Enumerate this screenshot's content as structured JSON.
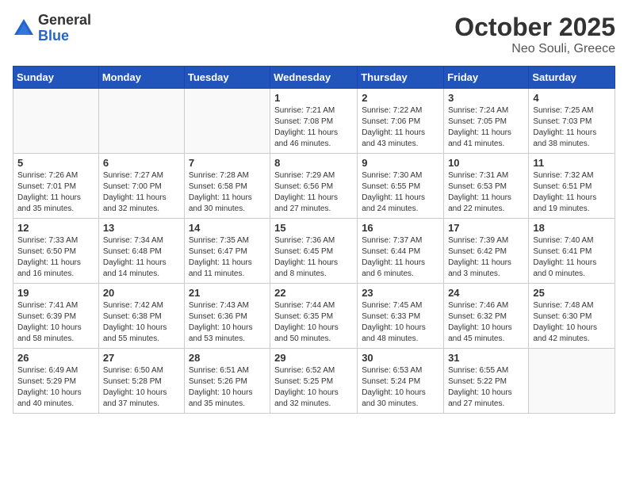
{
  "header": {
    "logo_general": "General",
    "logo_blue": "Blue",
    "month_year": "October 2025",
    "location": "Neo Souli, Greece"
  },
  "weekdays": [
    "Sunday",
    "Monday",
    "Tuesday",
    "Wednesday",
    "Thursday",
    "Friday",
    "Saturday"
  ],
  "weeks": [
    [
      {
        "day": "",
        "info": ""
      },
      {
        "day": "",
        "info": ""
      },
      {
        "day": "",
        "info": ""
      },
      {
        "day": "1",
        "info": "Sunrise: 7:21 AM\nSunset: 7:08 PM\nDaylight: 11 hours\nand 46 minutes."
      },
      {
        "day": "2",
        "info": "Sunrise: 7:22 AM\nSunset: 7:06 PM\nDaylight: 11 hours\nand 43 minutes."
      },
      {
        "day": "3",
        "info": "Sunrise: 7:24 AM\nSunset: 7:05 PM\nDaylight: 11 hours\nand 41 minutes."
      },
      {
        "day": "4",
        "info": "Sunrise: 7:25 AM\nSunset: 7:03 PM\nDaylight: 11 hours\nand 38 minutes."
      }
    ],
    [
      {
        "day": "5",
        "info": "Sunrise: 7:26 AM\nSunset: 7:01 PM\nDaylight: 11 hours\nand 35 minutes."
      },
      {
        "day": "6",
        "info": "Sunrise: 7:27 AM\nSunset: 7:00 PM\nDaylight: 11 hours\nand 32 minutes."
      },
      {
        "day": "7",
        "info": "Sunrise: 7:28 AM\nSunset: 6:58 PM\nDaylight: 11 hours\nand 30 minutes."
      },
      {
        "day": "8",
        "info": "Sunrise: 7:29 AM\nSunset: 6:56 PM\nDaylight: 11 hours\nand 27 minutes."
      },
      {
        "day": "9",
        "info": "Sunrise: 7:30 AM\nSunset: 6:55 PM\nDaylight: 11 hours\nand 24 minutes."
      },
      {
        "day": "10",
        "info": "Sunrise: 7:31 AM\nSunset: 6:53 PM\nDaylight: 11 hours\nand 22 minutes."
      },
      {
        "day": "11",
        "info": "Sunrise: 7:32 AM\nSunset: 6:51 PM\nDaylight: 11 hours\nand 19 minutes."
      }
    ],
    [
      {
        "day": "12",
        "info": "Sunrise: 7:33 AM\nSunset: 6:50 PM\nDaylight: 11 hours\nand 16 minutes."
      },
      {
        "day": "13",
        "info": "Sunrise: 7:34 AM\nSunset: 6:48 PM\nDaylight: 11 hours\nand 14 minutes."
      },
      {
        "day": "14",
        "info": "Sunrise: 7:35 AM\nSunset: 6:47 PM\nDaylight: 11 hours\nand 11 minutes."
      },
      {
        "day": "15",
        "info": "Sunrise: 7:36 AM\nSunset: 6:45 PM\nDaylight: 11 hours\nand 8 minutes."
      },
      {
        "day": "16",
        "info": "Sunrise: 7:37 AM\nSunset: 6:44 PM\nDaylight: 11 hours\nand 6 minutes."
      },
      {
        "day": "17",
        "info": "Sunrise: 7:39 AM\nSunset: 6:42 PM\nDaylight: 11 hours\nand 3 minutes."
      },
      {
        "day": "18",
        "info": "Sunrise: 7:40 AM\nSunset: 6:41 PM\nDaylight: 11 hours\nand 0 minutes."
      }
    ],
    [
      {
        "day": "19",
        "info": "Sunrise: 7:41 AM\nSunset: 6:39 PM\nDaylight: 10 hours\nand 58 minutes."
      },
      {
        "day": "20",
        "info": "Sunrise: 7:42 AM\nSunset: 6:38 PM\nDaylight: 10 hours\nand 55 minutes."
      },
      {
        "day": "21",
        "info": "Sunrise: 7:43 AM\nSunset: 6:36 PM\nDaylight: 10 hours\nand 53 minutes."
      },
      {
        "day": "22",
        "info": "Sunrise: 7:44 AM\nSunset: 6:35 PM\nDaylight: 10 hours\nand 50 minutes."
      },
      {
        "day": "23",
        "info": "Sunrise: 7:45 AM\nSunset: 6:33 PM\nDaylight: 10 hours\nand 48 minutes."
      },
      {
        "day": "24",
        "info": "Sunrise: 7:46 AM\nSunset: 6:32 PM\nDaylight: 10 hours\nand 45 minutes."
      },
      {
        "day": "25",
        "info": "Sunrise: 7:48 AM\nSunset: 6:30 PM\nDaylight: 10 hours\nand 42 minutes."
      }
    ],
    [
      {
        "day": "26",
        "info": "Sunrise: 6:49 AM\nSunset: 5:29 PM\nDaylight: 10 hours\nand 40 minutes."
      },
      {
        "day": "27",
        "info": "Sunrise: 6:50 AM\nSunset: 5:28 PM\nDaylight: 10 hours\nand 37 minutes."
      },
      {
        "day": "28",
        "info": "Sunrise: 6:51 AM\nSunset: 5:26 PM\nDaylight: 10 hours\nand 35 minutes."
      },
      {
        "day": "29",
        "info": "Sunrise: 6:52 AM\nSunset: 5:25 PM\nDaylight: 10 hours\nand 32 minutes."
      },
      {
        "day": "30",
        "info": "Sunrise: 6:53 AM\nSunset: 5:24 PM\nDaylight: 10 hours\nand 30 minutes."
      },
      {
        "day": "31",
        "info": "Sunrise: 6:55 AM\nSunset: 5:22 PM\nDaylight: 10 hours\nand 27 minutes."
      },
      {
        "day": "",
        "info": ""
      }
    ]
  ]
}
